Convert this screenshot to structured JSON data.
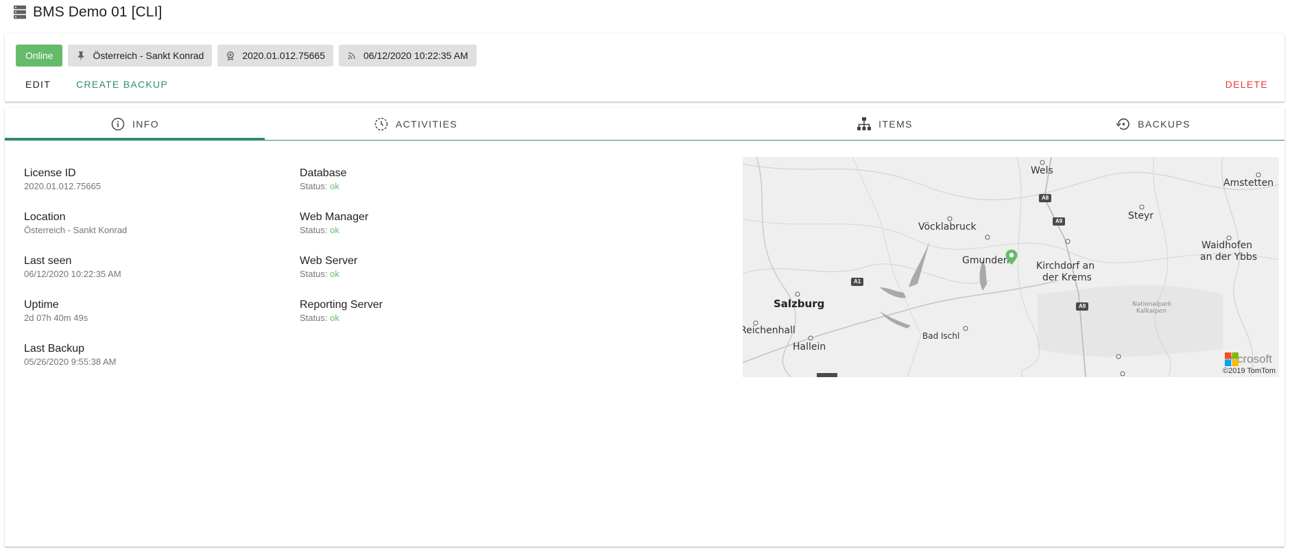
{
  "header": {
    "title": "BMS Demo 01 [CLI]",
    "icon": "server-icon"
  },
  "status_card": {
    "chips": [
      {
        "name": "status-online-chip",
        "text": "Online",
        "color": "#66bb6a"
      },
      {
        "name": "location-chip",
        "icon": "pin-icon",
        "text": "Österreich - Sankt Konrad"
      },
      {
        "name": "license-chip",
        "icon": "license-icon",
        "text": "2020.01.012.75665"
      },
      {
        "name": "last-seen-chip",
        "icon": "signal-icon",
        "text": "06/12/2020 10:22:35 AM"
      }
    ],
    "actions": {
      "edit": "EDIT",
      "create_backup": "CREATE BACKUP",
      "delete": "DELETE"
    },
    "accent_color": "#2e8b74",
    "danger_color": "#e53935"
  },
  "tabs": [
    {
      "label": "INFO",
      "icon": "info-icon",
      "active": true
    },
    {
      "label": "ACTIVITIES",
      "icon": "history-icon",
      "active": false
    },
    {
      "label": "ITEMS",
      "icon": "sitemap-icon",
      "active": false
    },
    {
      "label": "BACKUPS",
      "icon": "backup-restore-icon",
      "active": false
    }
  ],
  "info": {
    "license_id": {
      "label": "License ID",
      "value": "2020.01.012.75665"
    },
    "location": {
      "label": "Location",
      "value": "Österreich - Sankt Konrad"
    },
    "last_seen": {
      "label": "Last seen",
      "value": "06/12/2020 10:22:35 AM"
    },
    "uptime": {
      "label": "Uptime",
      "value": "2d 07h 40m 49s"
    },
    "last_backup": {
      "label": "Last Backup",
      "value": "05/26/2020 9:55:38 AM"
    }
  },
  "services": {
    "status_prefix": "Status:",
    "database": {
      "label": "Database",
      "status": "ok"
    },
    "web_manager": {
      "label": "Web Manager",
      "status": "ok"
    },
    "web_server": {
      "label": "Web Server",
      "status": "ok"
    },
    "reporting_server": {
      "label": "Reporting Server",
      "status": "ok"
    }
  },
  "map": {
    "cities": {
      "wels": "Wels",
      "amstetten": "Amstetten",
      "steyr": "Steyr",
      "voecklabruck": "Vöcklabruck",
      "gmunden": "Gmunden",
      "kirchdorf_1": "Kirchdorf an",
      "kirchdorf_2": "der Krems",
      "waidhofen_1": "Waidhofen",
      "waidhofen_2": "an der Ybbs",
      "salzburg": "Salzburg",
      "reichenhall": "Reichenhall",
      "hallein": "Hallein",
      "bad_ischl": "Bad Ischl",
      "nationalpark_1": "Nationalpark",
      "nationalpark_2": "Kalkalpen"
    },
    "roads": {
      "a8": "A8",
      "a9_north": "A9",
      "a9_south": "A9",
      "a1": "A1"
    },
    "brand": "Microsoft",
    "copyright": "©2019 TomTom",
    "pin_color": "#66bb6a"
  }
}
